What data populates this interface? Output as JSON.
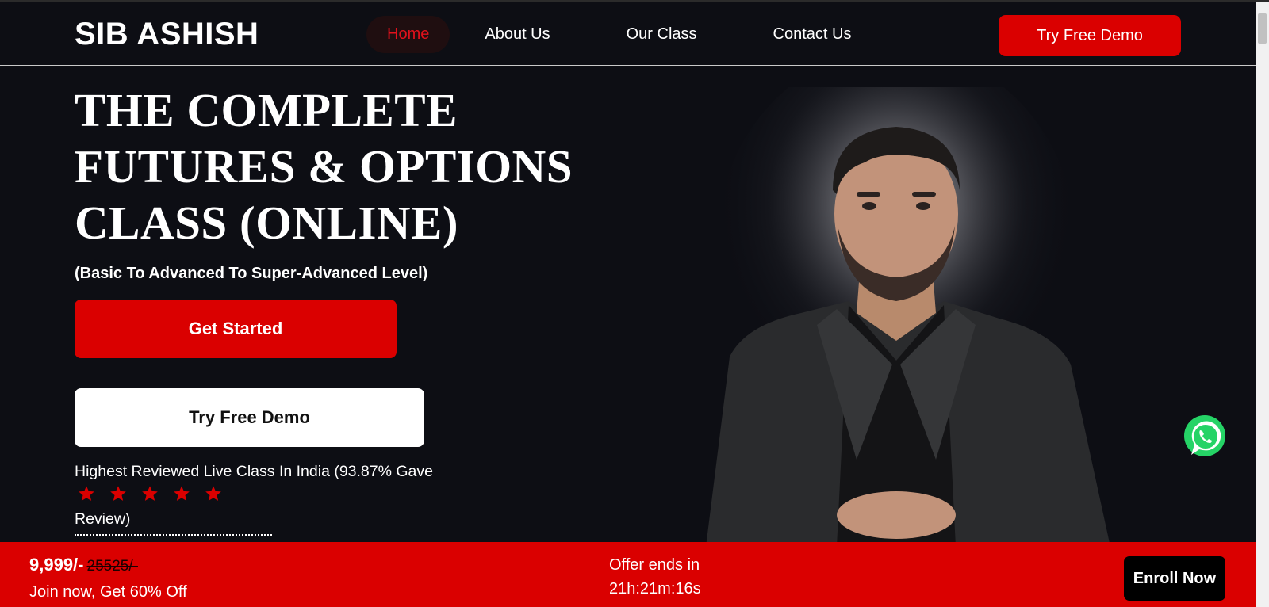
{
  "header": {
    "logo": "SIB ASHISH",
    "nav": [
      "Home",
      "About Us",
      "Our Class",
      "Contact Us"
    ],
    "active_nav": "Home",
    "demo_label": "Try Free Demo"
  },
  "hero": {
    "title": " THE COMPLETE\nFUTURES & OPTIONS\nCLASS (ONLINE)",
    "subtitle": "(Basic To Advanced To Super-Advanced Level)",
    "start_label": "Get Started",
    "demo_label": "Try Free Demo",
    "review_text": "Highest Reviewed Live Class In India (93.87% Gave",
    "review_tail": "Review)",
    "stars": 5
  },
  "offer": {
    "price": "9,999/-",
    "old_price": "25525/-",
    "join_text": "Join now, Get 60% Off",
    "ends_label": "Offer ends in",
    "timer": "21h:21m:16s",
    "enroll_label": "Enroll Now"
  },
  "colors": {
    "accent": "#da0000",
    "background": "#0d0e14",
    "whatsapp": "#25d366"
  },
  "icons": {
    "star": "star-icon",
    "whatsapp": "whatsapp-icon"
  }
}
